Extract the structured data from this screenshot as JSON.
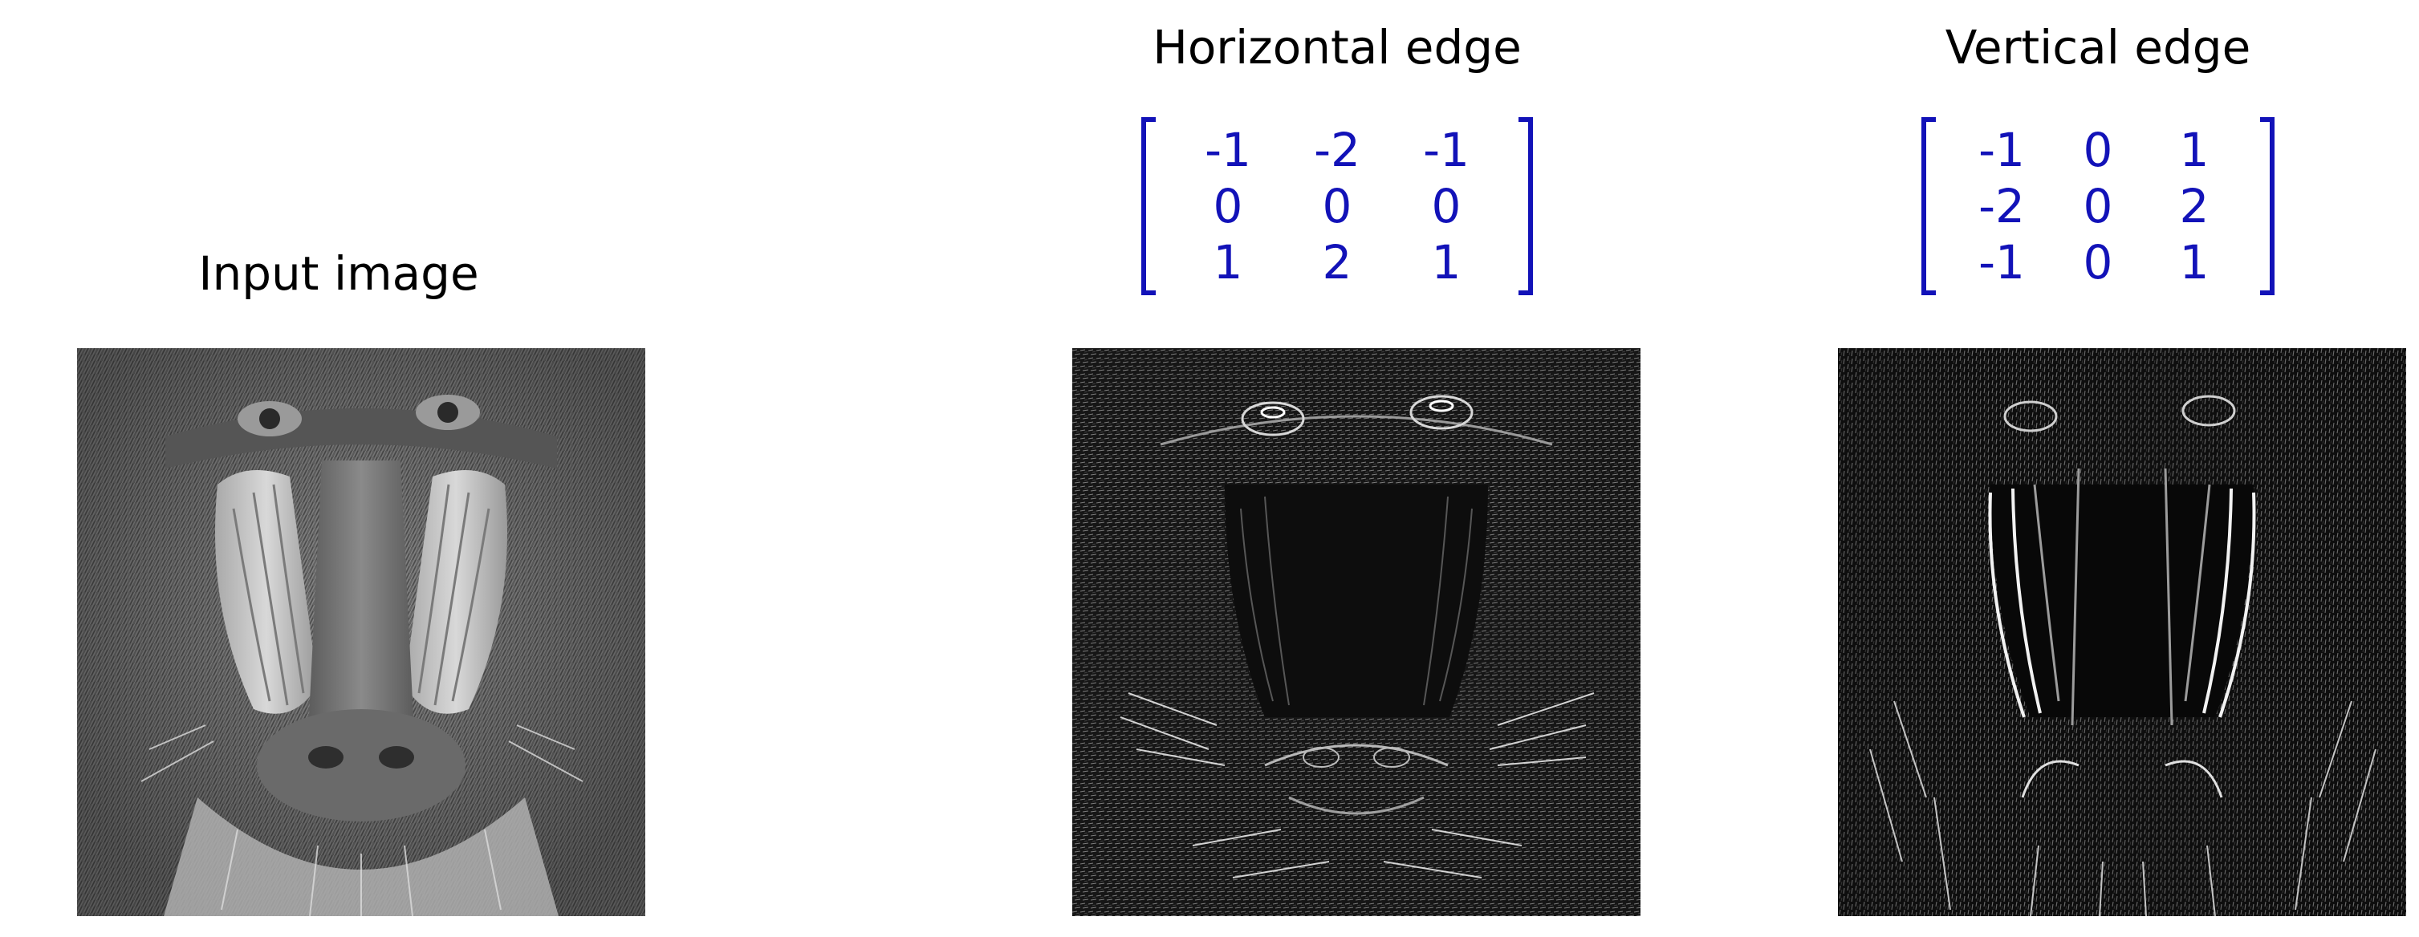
{
  "panels": [
    {
      "title": "Input image",
      "style": "grayscale-photo",
      "kernel": null
    },
    {
      "title": "Horizontal edge",
      "style": "horizontal-edge-map",
      "kernel": [
        [
          "-1",
          "-2",
          "-1"
        ],
        [
          "0",
          "0",
          "0"
        ],
        [
          "1",
          "2",
          "1"
        ]
      ]
    },
    {
      "title": "Vertical edge",
      "style": "vertical-edge-map",
      "kernel": [
        [
          "-1",
          "0",
          "1"
        ],
        [
          "-2",
          "0",
          "2"
        ],
        [
          "-1",
          "0",
          "1"
        ]
      ]
    }
  ],
  "colors": {
    "kernel": "#1212b8",
    "title": "#000000",
    "background": "#ffffff"
  },
  "icons": {
    "input_image": "mandrill-face-photo",
    "horizontal_output": "mandrill-horizontal-edge-map",
    "vertical_output": "mandrill-vertical-edge-map"
  }
}
